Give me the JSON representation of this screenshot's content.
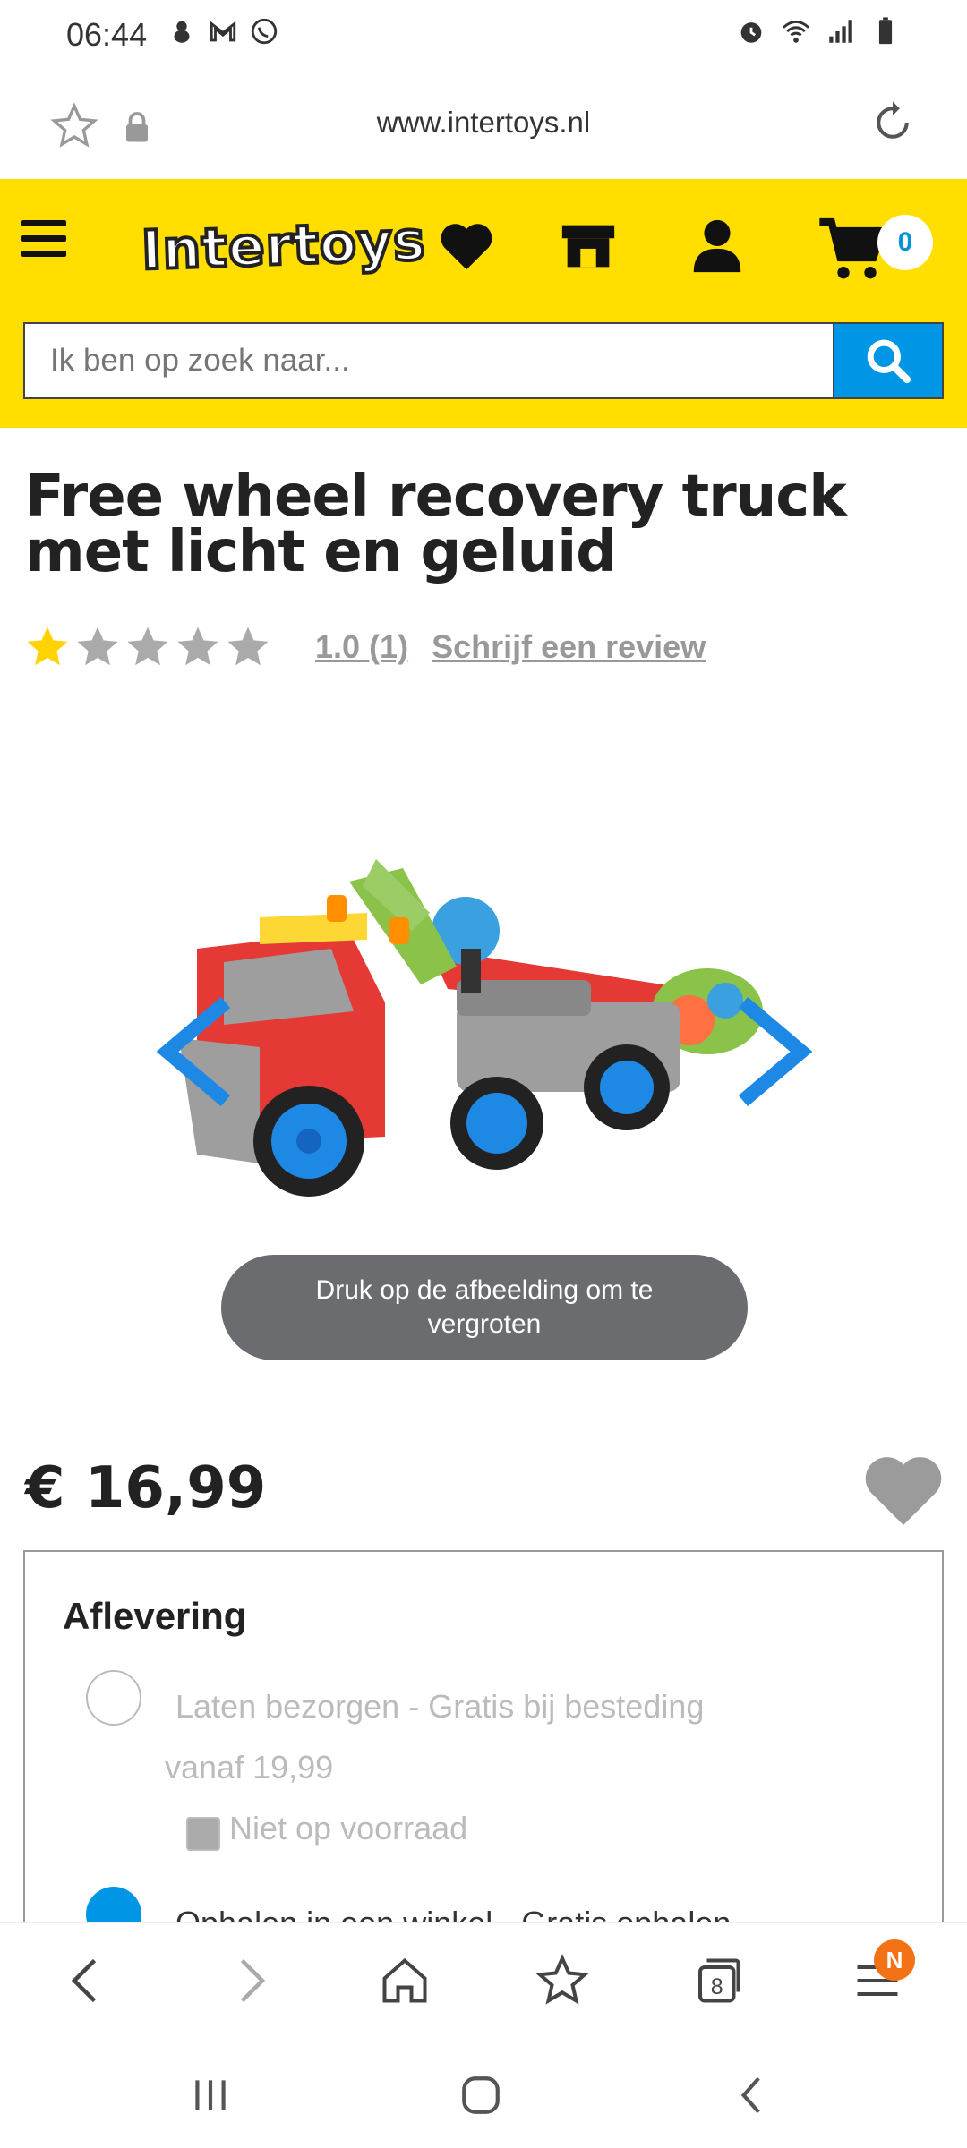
{
  "status_bar": {
    "time": "06:44"
  },
  "url_bar": {
    "url": "www.intertoys.nl"
  },
  "header": {
    "logo_text": "Intertoys",
    "cart_count": "0",
    "search_placeholder": "Ik ben op zoek naar..."
  },
  "product": {
    "title": "Free wheel recovery truck met licht en geluid",
    "rating": "1.0",
    "rating_count": "(1)",
    "rating_stars_filled": 1,
    "rating_stars_total": 5,
    "review_link": "Schrijf een review",
    "zoom_hint": "Druk op de afbeelding om te vergroten",
    "price": "€ 16,99"
  },
  "delivery": {
    "title": "Aflevering",
    "option1_line1": "Laten bezorgen - Gratis bij besteding",
    "option1_line2": "vanaf 19,99",
    "option1_stock": "Niet op voorraad",
    "option2_label": "Ophalen in een winkel - Gratis ophalen"
  },
  "browser_nav": {
    "menu_badge": "N",
    "tabs_count": "8"
  },
  "colors": {
    "header_yellow": "#ffde00",
    "accent_blue": "#0096e6",
    "star_yellow": "#ffd200",
    "badge_orange": "#f47216"
  }
}
